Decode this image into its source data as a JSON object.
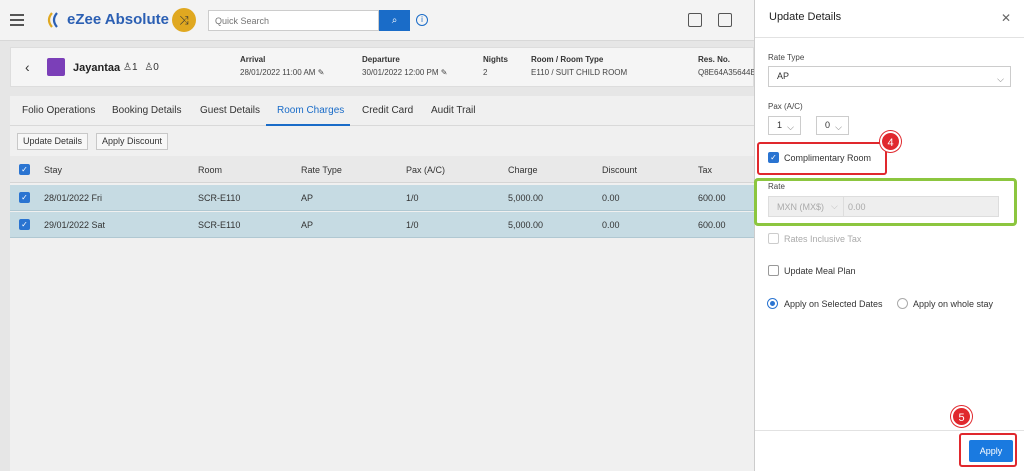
{
  "app": {
    "logo_text": "eZee Absolute",
    "search_placeholder": "Quick Search"
  },
  "guest": {
    "name": "Jayantaa",
    "pax": "1 0",
    "arrival_label": "Arrival",
    "arrival": "28/01/2022 11:00 AM",
    "departure_label": "Departure",
    "departure": "30/01/2022 12:00 PM",
    "nights_label": "Nights",
    "nights": "2",
    "room_label": "Room / Room Type",
    "room": "E110 / SUIT CHILD ROOM",
    "resno_label": "Res. No.",
    "resno": "Q8E64A35644E"
  },
  "tabs": [
    "Folio Operations",
    "Booking Details",
    "Guest Details",
    "Room Charges",
    "Credit Card",
    "Audit Trail"
  ],
  "actions": {
    "update_details": "Update Details",
    "apply_discount": "Apply Discount"
  },
  "table": {
    "headers": [
      "Stay",
      "Room",
      "Rate Type",
      "Pax (A/C)",
      "Charge",
      "Discount",
      "Tax"
    ],
    "rows": [
      [
        "28/01/2022 Fri",
        "SCR-E110",
        "AP",
        "1/0",
        "5,000.00",
        "0.00",
        "600.00"
      ],
      [
        "29/01/2022 Sat",
        "SCR-E110",
        "AP",
        "1/0",
        "5,000.00",
        "0.00",
        "600.00"
      ]
    ]
  },
  "panel": {
    "title": "Update Details",
    "rate_type_label": "Rate Type",
    "rate_type_value": "AP",
    "pax_label": "Pax (A/C)",
    "pax_adult": "1",
    "pax_child": "0",
    "complimentary_label": "Complimentary Room",
    "rate_label": "Rate",
    "rate_currency": "MXN (MX$)",
    "rate_value": "0.00",
    "rates_inclusive_label": "Rates Inclusive Tax",
    "meal_plan_label": "Update Meal Plan",
    "apply_selected_label": "Apply on Selected Dates",
    "apply_whole_label": "Apply on whole stay",
    "apply_button": "Apply"
  },
  "annotations": {
    "step4": "4",
    "step5": "5"
  },
  "colors": {
    "accent": "#1a6cc8",
    "highlight_red": "#e0282d",
    "highlight_green": "#8cc63f",
    "selected_row": "#c6dbe3"
  }
}
